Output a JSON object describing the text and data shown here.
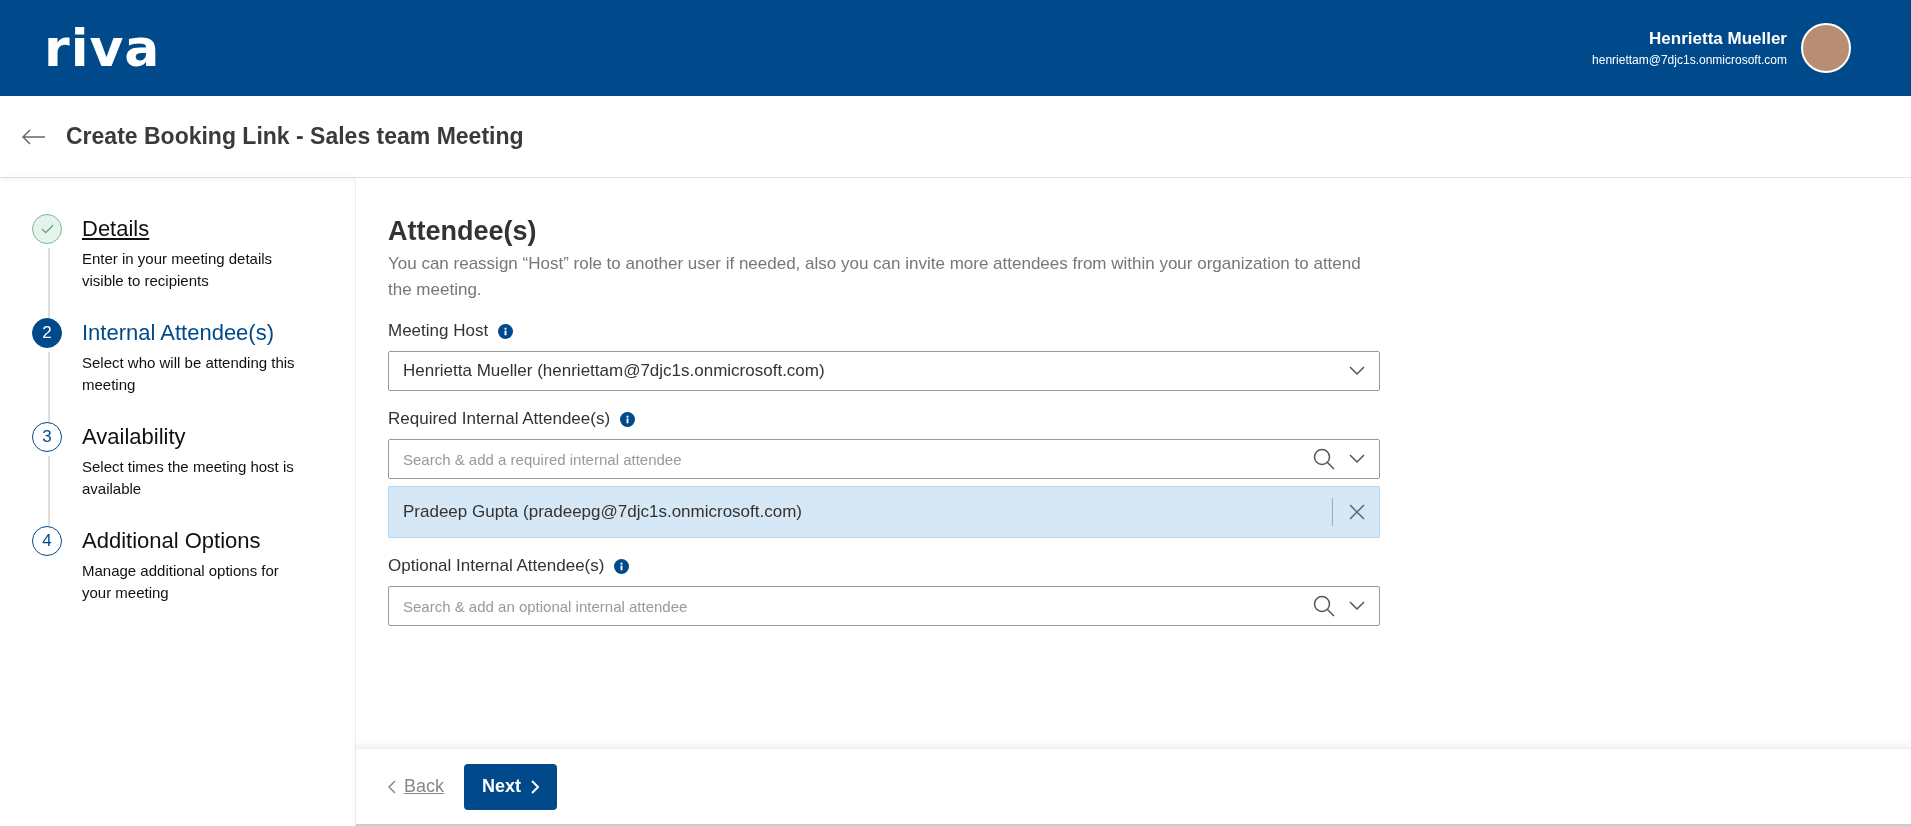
{
  "header": {
    "logo": "riva",
    "user_name": "Henrietta Mueller",
    "user_email": "henriettam@7djc1s.onmicrosoft.com"
  },
  "title_bar": {
    "title": "Create Booking Link - Sales team Meeting"
  },
  "steps": [
    {
      "kind": "done",
      "title": "Details",
      "description": "Enter in your meeting details visible to recipients"
    },
    {
      "kind": "current",
      "number": "2",
      "title": "Internal Attendee(s)",
      "description": "Select who will be attending this meeting"
    },
    {
      "kind": "todo",
      "number": "3",
      "title": "Availability",
      "description": "Select times the meeting host is available"
    },
    {
      "kind": "todo",
      "number": "4",
      "title": "Additional Options",
      "description": "Manage additional options for your meeting"
    }
  ],
  "section": {
    "heading": "Attendee(s)",
    "description": "You can reassign “Host” role to another user if needed, also you can invite more attendees from within your organization to attend the meeting."
  },
  "fields": [
    {
      "kind": "select",
      "label": "Meeting Host",
      "value": "Henrietta Mueller (henriettam@7djc1s.onmicrosoft.com)"
    },
    {
      "kind": "search",
      "label": "Required Internal Attendee(s)",
      "placeholder": "Search & add a required internal attendee",
      "chips": [
        "Pradeep Gupta (pradeepg@7djc1s.onmicrosoft.com)"
      ]
    },
    {
      "kind": "search",
      "label": "Optional Internal Attendee(s)",
      "placeholder": "Search & add an optional internal attendee"
    }
  ],
  "footer": {
    "back": "Back",
    "next": "Next"
  }
}
